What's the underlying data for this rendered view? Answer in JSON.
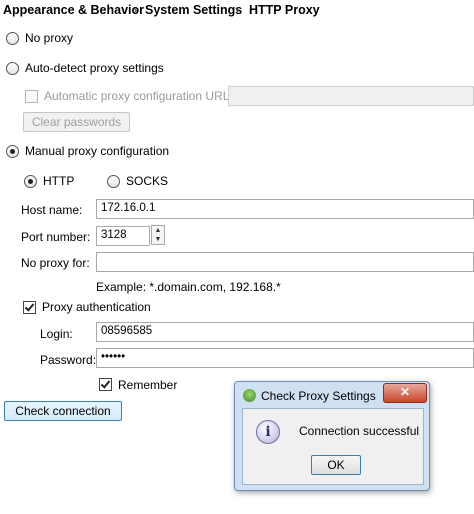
{
  "breadcrumb": {
    "item1": "Appearance & Behavior",
    "sep": "›",
    "item2": "System Settings",
    "item3": "HTTP Proxy"
  },
  "proxy_mode": {
    "no_proxy": "No proxy",
    "auto_detect": "Auto-detect proxy settings",
    "auto_config_url_label": "Automatic proxy configuration URL:",
    "auto_config_url_value": "",
    "clear_passwords": "Clear passwords",
    "manual": "Manual proxy configuration",
    "selected": "manual"
  },
  "protocol": {
    "http": "HTTP",
    "socks": "SOCKS",
    "selected": "HTTP"
  },
  "host": {
    "label": "Host name:",
    "value": "172.16.0.1"
  },
  "port": {
    "label": "Port number:",
    "value": "3128"
  },
  "no_proxy_for": {
    "label": "No proxy for:",
    "value": "",
    "example": "Example: *.domain.com, 192.168.*"
  },
  "auth": {
    "checkbox_label": "Proxy authentication",
    "checked": true,
    "login_label": "Login:",
    "login_value": "08596585",
    "password_label": "Password:",
    "password_value": "••••••",
    "remember_label": "Remember",
    "remember_checked": true
  },
  "check_connection": "Check connection",
  "dialog": {
    "title": "Check Proxy Settings",
    "close_glyph": "✕",
    "info_glyph": "i",
    "message": "Connection successful",
    "ok": "OK"
  }
}
